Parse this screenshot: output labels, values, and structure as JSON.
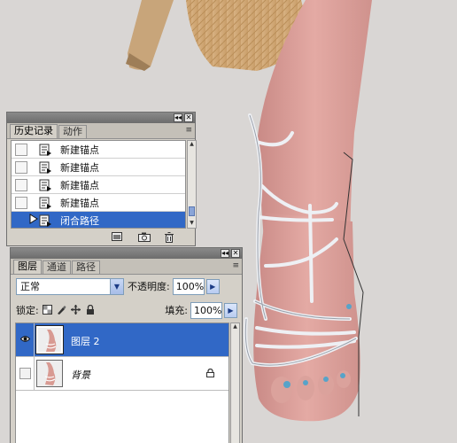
{
  "history_panel": {
    "title_buttons": [
      "◂◂",
      "✕"
    ],
    "tabs": [
      {
        "label": "历史记录",
        "active": true
      },
      {
        "label": "动作",
        "active": false
      }
    ],
    "menu_icon": "≡",
    "items": [
      {
        "label": "新建锚点",
        "selected": false
      },
      {
        "label": "新建锚点",
        "selected": false
      },
      {
        "label": "新建锚点",
        "selected": false
      },
      {
        "label": "新建锚点",
        "selected": false
      },
      {
        "label": "闭合路径",
        "selected": true
      }
    ],
    "footer_icons": [
      "new-document-from-state-icon",
      "create-snapshot-icon",
      "trash-icon"
    ],
    "selected_color": "#3168c6"
  },
  "layers_panel": {
    "title_buttons": [
      "◂◂",
      "✕"
    ],
    "tabs": [
      {
        "label": "图层",
        "active": true
      },
      {
        "label": "通道",
        "active": false
      },
      {
        "label": "路径",
        "active": false
      }
    ],
    "menu_icon": "≡",
    "blend_mode": "正常",
    "opacity_label": "不透明度:",
    "opacity_value": "100%",
    "lock_label": "锁定:",
    "fill_label": "填充:",
    "fill_value": "100%",
    "layers": [
      {
        "name": "图层 2",
        "visible": true,
        "selected": true,
        "locked": false
      },
      {
        "name": "背景",
        "visible": false,
        "selected": false,
        "locked": true
      }
    ]
  }
}
